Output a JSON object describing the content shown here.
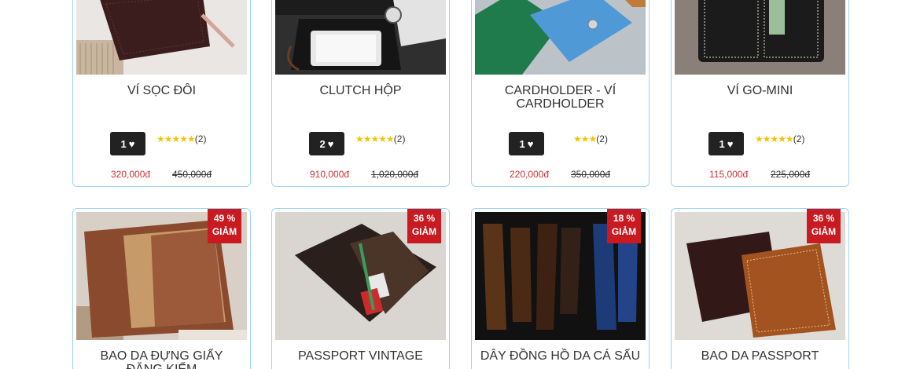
{
  "products_row1": [
    {
      "name": "Ví sọc đôi",
      "likes": "1",
      "rating_stars": 5,
      "reviews": "(2)",
      "price": "320,000đ",
      "old_price": "450,000đ"
    },
    {
      "name": "Clutch hộp",
      "likes": "2",
      "rating_stars": 5,
      "reviews": "(2)",
      "price": "910,000đ",
      "old_price": "1,020,000đ"
    },
    {
      "name": "Cardholder - Ví Cardholder",
      "likes": "1",
      "rating_stars": 3,
      "reviews": "(2)",
      "price": "220,000đ",
      "old_price": "350,000đ"
    },
    {
      "name": "Ví Go-Mini",
      "likes": "1",
      "rating_stars": 5,
      "reviews": "(2)",
      "price": "115,000đ",
      "old_price": "225,000đ"
    }
  ],
  "products_row2": [
    {
      "name": "Bao da đựng giấy đăng kiểm",
      "discount_pct": "49 %",
      "discount_word": "GIẢM"
    },
    {
      "name": "Passport vintage",
      "discount_pct": "36 %",
      "discount_word": "GIẢM"
    },
    {
      "name": "Dây đồng hồ da cá sấu",
      "discount_pct": "18 %",
      "discount_word": "GIẢM"
    },
    {
      "name": "Bao da passport",
      "discount_pct": "36 %",
      "discount_word": "GIẢM"
    }
  ],
  "icons": {
    "like": "heart-icon",
    "rating": "star-icon"
  },
  "colors": {
    "price": "#d32f2f",
    "badge": "#c91a22",
    "card_border": "#9fd4ef",
    "star": "#f5c300"
  }
}
